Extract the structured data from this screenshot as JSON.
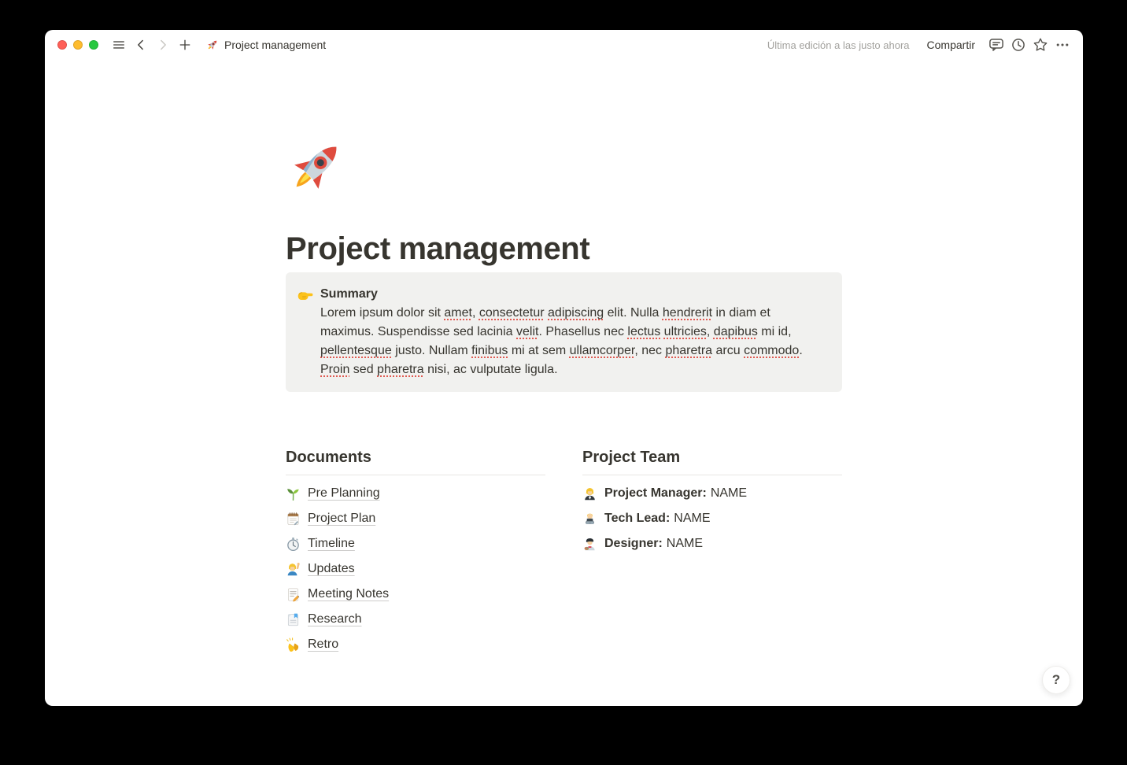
{
  "titlebar": {
    "window_controls": {
      "close": "close",
      "minimize": "minimize",
      "zoom": "zoom"
    },
    "sidebar_toggle_icon": "hamburger",
    "nav": {
      "back_icon": "chevron-left",
      "forward_icon": "chevron-right",
      "new_page_icon": "plus"
    },
    "breadcrumb": {
      "icon": "rocket",
      "title": "Project management"
    },
    "edited_status": "Última edición a las justo ahora",
    "share_label": "Compartir",
    "action_icons": {
      "comments": "comment",
      "updates": "history-clock",
      "favorite": "star",
      "more": "ellipsis"
    }
  },
  "page": {
    "icon": "rocket",
    "title": "Project management",
    "callout": {
      "icon": "pointing-right",
      "heading": "Summary",
      "segments": [
        {
          "text": "Lorem ipsum dolor sit ",
          "misspelled": false
        },
        {
          "text": "amet",
          "misspelled": true
        },
        {
          "text": ", ",
          "misspelled": false
        },
        {
          "text": "consectetur",
          "misspelled": true
        },
        {
          "text": " ",
          "misspelled": false
        },
        {
          "text": "adipiscing",
          "misspelled": true
        },
        {
          "text": " elit. Nulla ",
          "misspelled": false
        },
        {
          "text": "hendrerit",
          "misspelled": true
        },
        {
          "text": " in diam et maximus. Suspendisse sed lacinia ",
          "misspelled": false
        },
        {
          "text": "velit",
          "misspelled": true
        },
        {
          "text": ". Phasellus nec ",
          "misspelled": false
        },
        {
          "text": "lectus",
          "misspelled": true
        },
        {
          "text": " ",
          "misspelled": false
        },
        {
          "text": "ultricies",
          "misspelled": true
        },
        {
          "text": ", ",
          "misspelled": false
        },
        {
          "text": "dapibus",
          "misspelled": true
        },
        {
          "text": " mi id, ",
          "misspelled": false
        },
        {
          "text": "pellentesque",
          "misspelled": true
        },
        {
          "text": " justo. Nullam ",
          "misspelled": false
        },
        {
          "text": "finibus",
          "misspelled": true
        },
        {
          "text": " mi at sem ",
          "misspelled": false
        },
        {
          "text": "ullamcorper",
          "misspelled": true
        },
        {
          "text": ", nec ",
          "misspelled": false
        },
        {
          "text": "pharetra",
          "misspelled": true
        },
        {
          "text": " arcu ",
          "misspelled": false
        },
        {
          "text": "commodo",
          "misspelled": true
        },
        {
          "text": ". ",
          "misspelled": false
        },
        {
          "text": "Proin",
          "misspelled": true
        },
        {
          "text": " sed ",
          "misspelled": false
        },
        {
          "text": "pharetra",
          "misspelled": true
        },
        {
          "text": " nisi, ac vulputate ligula.",
          "misspelled": false
        }
      ]
    },
    "documents": {
      "heading": "Documents",
      "items": [
        {
          "icon": "seedling",
          "label": "Pre Planning"
        },
        {
          "icon": "spiral-notepad",
          "label": "Project Plan"
        },
        {
          "icon": "stopwatch",
          "label": "Timeline"
        },
        {
          "icon": "woman-raising-hand",
          "label": "Updates"
        },
        {
          "icon": "memo",
          "label": "Meeting Notes"
        },
        {
          "icon": "bookmark-tabs",
          "label": "Research"
        },
        {
          "icon": "clapping-hands",
          "label": "Retro"
        }
      ]
    },
    "team": {
      "heading": "Project Team",
      "members": [
        {
          "icon": "woman-office-worker",
          "role": "Project Manager:",
          "name": "NAME"
        },
        {
          "icon": "man-technologist",
          "role": "Tech Lead:",
          "name": "NAME"
        },
        {
          "icon": "man-artist",
          "role": "Designer:",
          "name": "NAME"
        }
      ]
    }
  },
  "help_button": {
    "label": "?"
  },
  "colors": {
    "traffic_red": "#ff5f57",
    "traffic_yellow": "#febc2e",
    "traffic_green": "#28c840",
    "text": "#37352f",
    "muted_text": "#a3a29e",
    "callout_bg": "#f1f1ef",
    "divider": "#e7e6e3",
    "spellcheck_underline": "#e05a52",
    "window_bg": "#ffffff"
  }
}
